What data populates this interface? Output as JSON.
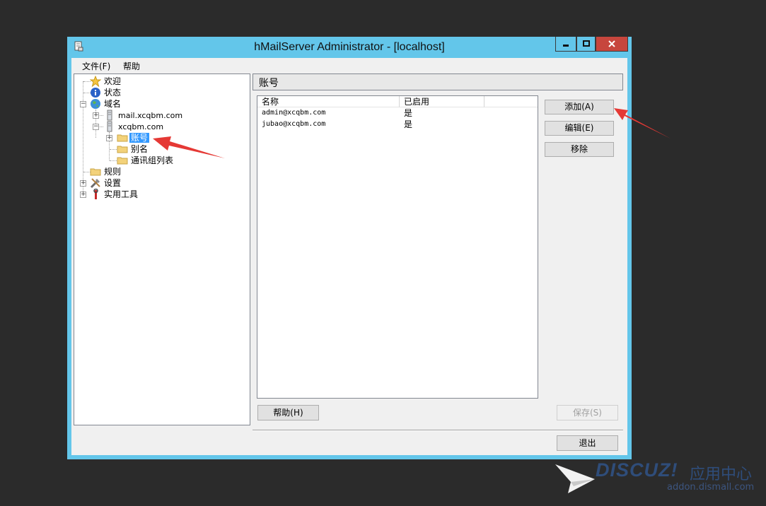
{
  "window": {
    "title": "hMailServer Administrator - [localhost]",
    "colors": {
      "frame": "#63c6ea",
      "close": "#c7463d",
      "selection": "#3399ff",
      "annotation": "#e53935"
    }
  },
  "menubar": {
    "file": "文件(F)",
    "help": "帮助"
  },
  "tree": {
    "welcome": "欢迎",
    "status": "状态",
    "domains": "域名",
    "domain1": "mail.xcqbm.com",
    "domain2": "xcqbm.com",
    "accounts": "账号",
    "aliases": "别名",
    "distribution_lists": "通讯组列表",
    "rules": "规则",
    "settings": "设置",
    "utilities": "实用工具"
  },
  "panel": {
    "title": "账号",
    "columns": {
      "name": "名称",
      "enabled": "已启用"
    },
    "rows": [
      {
        "email": "admin@xcqbm.com",
        "enabled": "是"
      },
      {
        "email": "jubao@xcqbm.com",
        "enabled": "是"
      }
    ]
  },
  "buttons": {
    "add": "添加(A)",
    "edit": "编辑(E)",
    "remove": "移除",
    "help": "帮助(H)",
    "save": "保存(S)",
    "exit": "退出"
  },
  "watermark": {
    "brand": "DISCUZ!",
    "brand_cn": "应用中心",
    "url": "addon.dismall.com"
  }
}
